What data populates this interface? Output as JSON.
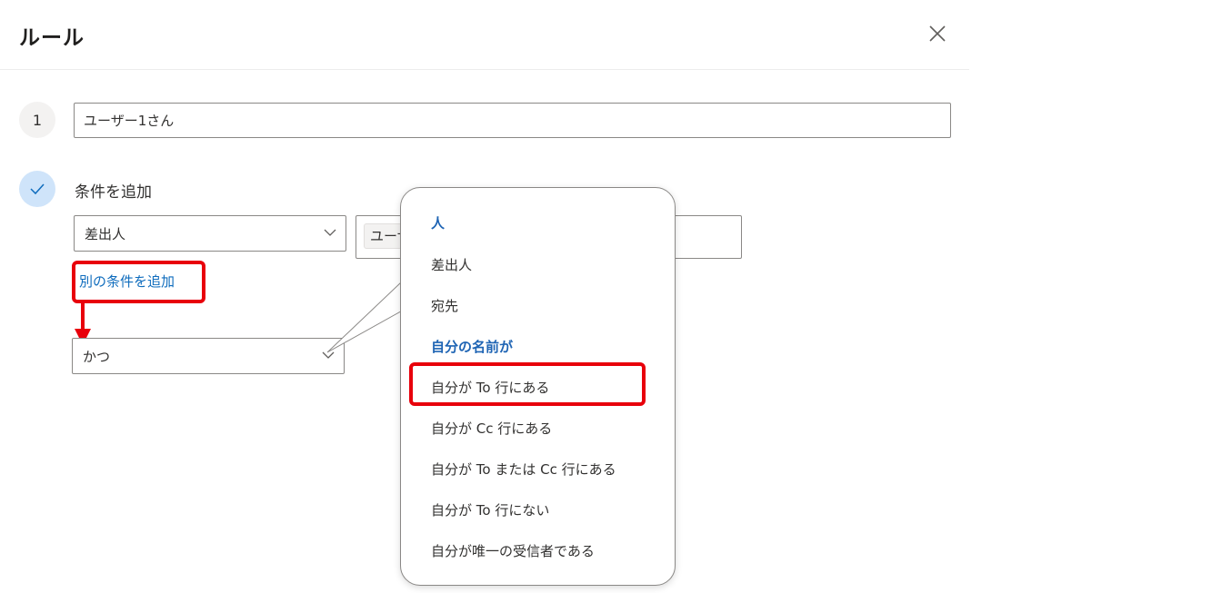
{
  "panel": {
    "title": "ルール",
    "close_icon": "close-icon"
  },
  "steps": {
    "step1_number": "1",
    "step2_icon": "checkmark-icon"
  },
  "rule_name": {
    "value": "ユーザー1さん"
  },
  "conditions": {
    "section_label": "条件を追加",
    "condition_select_value": "差出人",
    "value_chip": "ユーザ",
    "add_another_link": "別の条件を追加",
    "connector_select_value": "かつ"
  },
  "dropdown": {
    "header_people": "人",
    "item_from": "差出人",
    "item_to": "宛先",
    "header_my_name": "自分の名前が",
    "item_on_to_line": "自分が To 行にある",
    "item_on_cc_line": "自分が Cc 行にある",
    "item_on_to_or_cc_line": "自分が To または Cc 行にある",
    "item_not_on_to_line": "自分が To 行にない",
    "item_only_recipient": "自分が唯一の受信者である"
  },
  "colors": {
    "accent": "#0f6cbd",
    "header_text": "#1e64b4",
    "annotation_red": "#e8000b"
  }
}
